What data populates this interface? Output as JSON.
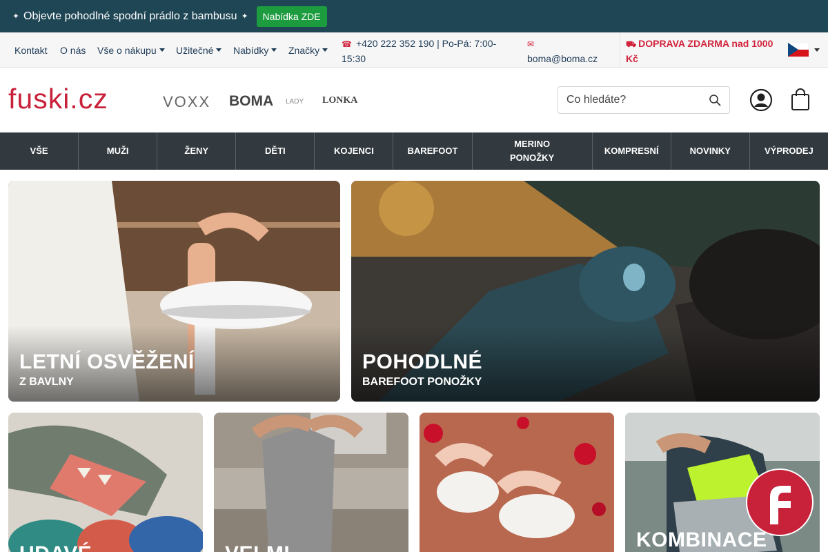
{
  "promo": {
    "text": "Objevte pohodlné spodní prádlo z bambusu",
    "button": "Nabídka ZDE",
    "left_icon": "star-icon",
    "right_icon": "star-icon"
  },
  "topnav": {
    "links": [
      "Kontakt",
      "O nás",
      "Vše o nákupu",
      "Užitečné",
      "Nabídky",
      "Značky"
    ],
    "phone": "+420 222 352 190 | Po-Pá: 7:00-15:30",
    "email": "boma@boma.cz",
    "shipping": "DOPRAVA ZDARMA nad 1000 Kč",
    "phone_icon": "phone-icon",
    "email_icon": "envelope-icon",
    "truck_icon": "truck-icon",
    "language_flag": "czech-flag"
  },
  "header": {
    "logo": "fuski.cz",
    "brands": [
      "VOXX",
      "BOMA",
      "LADY",
      "LONKA"
    ],
    "search_placeholder": "Co hledáte?",
    "account_icon": "user-icon",
    "cart_icon": "shopping-bag-icon"
  },
  "categories": [
    "VŠE",
    "MUŽI",
    "ŽENY",
    "DĚTI",
    "KOJENCI",
    "BAREFOOT",
    "MERINO PONOŽKY",
    "KOMPRESNÍ",
    "NOVINKY",
    "VÝPRODEJ"
  ],
  "tiles": [
    {
      "title": "LETNÍ OSVĚŽENÍ",
      "subtitle": "Z BAVLNY"
    },
    {
      "title": "POHODLNÉ",
      "subtitle": "BAREFOOT PONOŽKY"
    },
    {
      "title": "UDAVÉ",
      "subtitle": ""
    },
    {
      "title": "VELMI",
      "subtitle": ""
    },
    {
      "title": "",
      "subtitle": ""
    },
    {
      "title": "KOMBINACE",
      "subtitle": ""
    }
  ],
  "colors": {
    "brand_red": "#c8213a",
    "promo_bg": "#1f4655",
    "promo_button": "#1d9b3f",
    "category_bar": "#333a3f"
  }
}
